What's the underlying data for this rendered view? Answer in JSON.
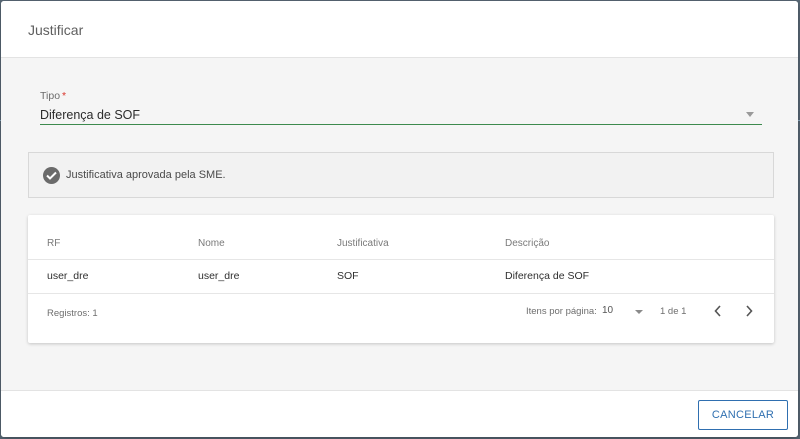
{
  "dialog": {
    "title": "Justificar"
  },
  "tipo_field": {
    "label": "Tipo",
    "required_mark": "*",
    "value": "Diferença de SOF"
  },
  "notice": {
    "icon": "check-circle-icon",
    "text": "Justificativa aprovada pela SME."
  },
  "table": {
    "headers": [
      "RF",
      "Nome",
      "Justificativa",
      "Descrição"
    ],
    "rows": [
      [
        "user_dre",
        "user_dre",
        "SOF",
        "Diferença de SOF"
      ]
    ],
    "footer": {
      "records": "Registros: 1",
      "items_per_page_label": "Itens por página:",
      "page_size": "10",
      "range": "1 de 1"
    }
  },
  "footer": {
    "cancel_label": "CANCELAR"
  },
  "colors": {
    "accent": "#2f6fb0",
    "field_underline": "#3d8a4e",
    "required": "#d9342b"
  }
}
